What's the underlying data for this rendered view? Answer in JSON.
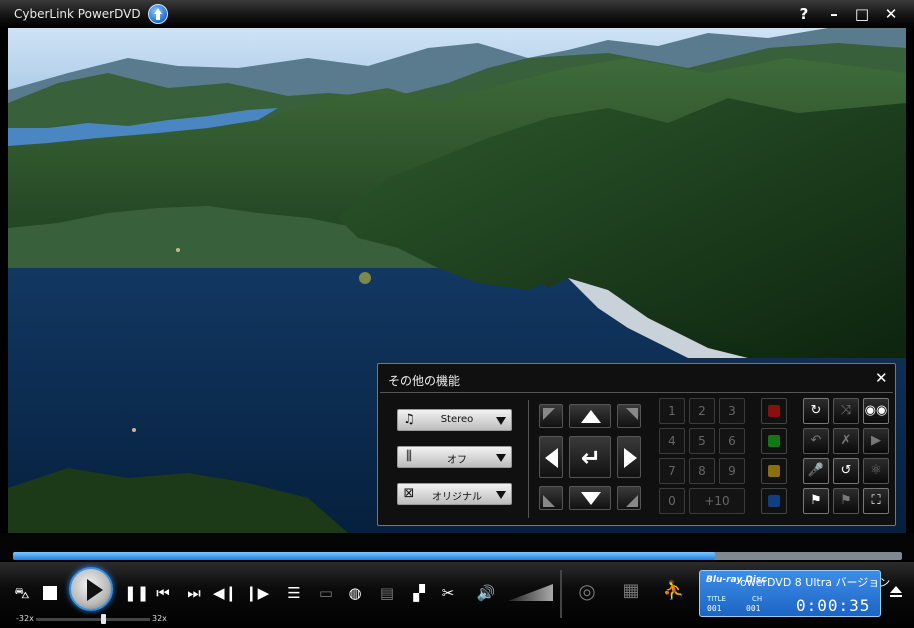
{
  "window": {
    "title": "CyberLink PowerDVD",
    "help_label": "?",
    "minimize_label": "–",
    "maximize_label": "□",
    "close_label": "✕"
  },
  "playback": {
    "progress": 0.79
  },
  "speed": {
    "min_label": "-32x",
    "max_label": "32x"
  },
  "lcd": {
    "disc_logo": "Blu-ray Disc",
    "version_text": "owerDVD 8 Ultra バージョン",
    "title_label": "TITLE",
    "title_value": "001",
    "chapter_label": "CH",
    "chapter_value": "001",
    "time": "0:00:35"
  },
  "panel": {
    "title": "その他の機能",
    "close_label": "✕",
    "dropdowns": [
      {
        "icon": "music-note-icon",
        "glyph": "♫",
        "value": "Stereo"
      },
      {
        "icon": "equalizer-icon",
        "glyph": "⫼",
        "value": "オフ"
      },
      {
        "icon": "aspect-ratio-icon",
        "glyph": "⊠",
        "value": "オリジナル"
      }
    ],
    "numbers": [
      "1",
      "2",
      "3",
      "4",
      "5",
      "6",
      "7",
      "8",
      "9",
      "0",
      "+10"
    ],
    "color_buttons": [
      "#8a0f0f",
      "#0f7a14",
      "#8a6f0f",
      "#0f3f80"
    ],
    "functions": [
      {
        "name": "repeat-icon",
        "glyph": "↻",
        "dim": false
      },
      {
        "name": "shuffle-icon",
        "glyph": "⤨",
        "dim": true
      },
      {
        "name": "view-icon",
        "glyph": "◉◉",
        "dim": false
      },
      {
        "name": "no-repeat-icon",
        "glyph": "↶",
        "dim": true
      },
      {
        "name": "magic-wand-icon",
        "glyph": "✗",
        "dim": true
      },
      {
        "name": "camera-icon",
        "glyph": "▶",
        "dim": true
      },
      {
        "name": "microphone-icon",
        "glyph": "🎤",
        "dim": false
      },
      {
        "name": "return-arrow-icon",
        "glyph": "↺",
        "dim": false
      },
      {
        "name": "atom-icon",
        "glyph": "⚛",
        "dim": true
      },
      {
        "name": "bookmark-add-icon",
        "glyph": "⚑",
        "dim": false
      },
      {
        "name": "bookmark-icon",
        "glyph": "⚑",
        "dim": true
      },
      {
        "name": "fullscreen-icon",
        "glyph": "⛶",
        "dim": false
      }
    ]
  }
}
